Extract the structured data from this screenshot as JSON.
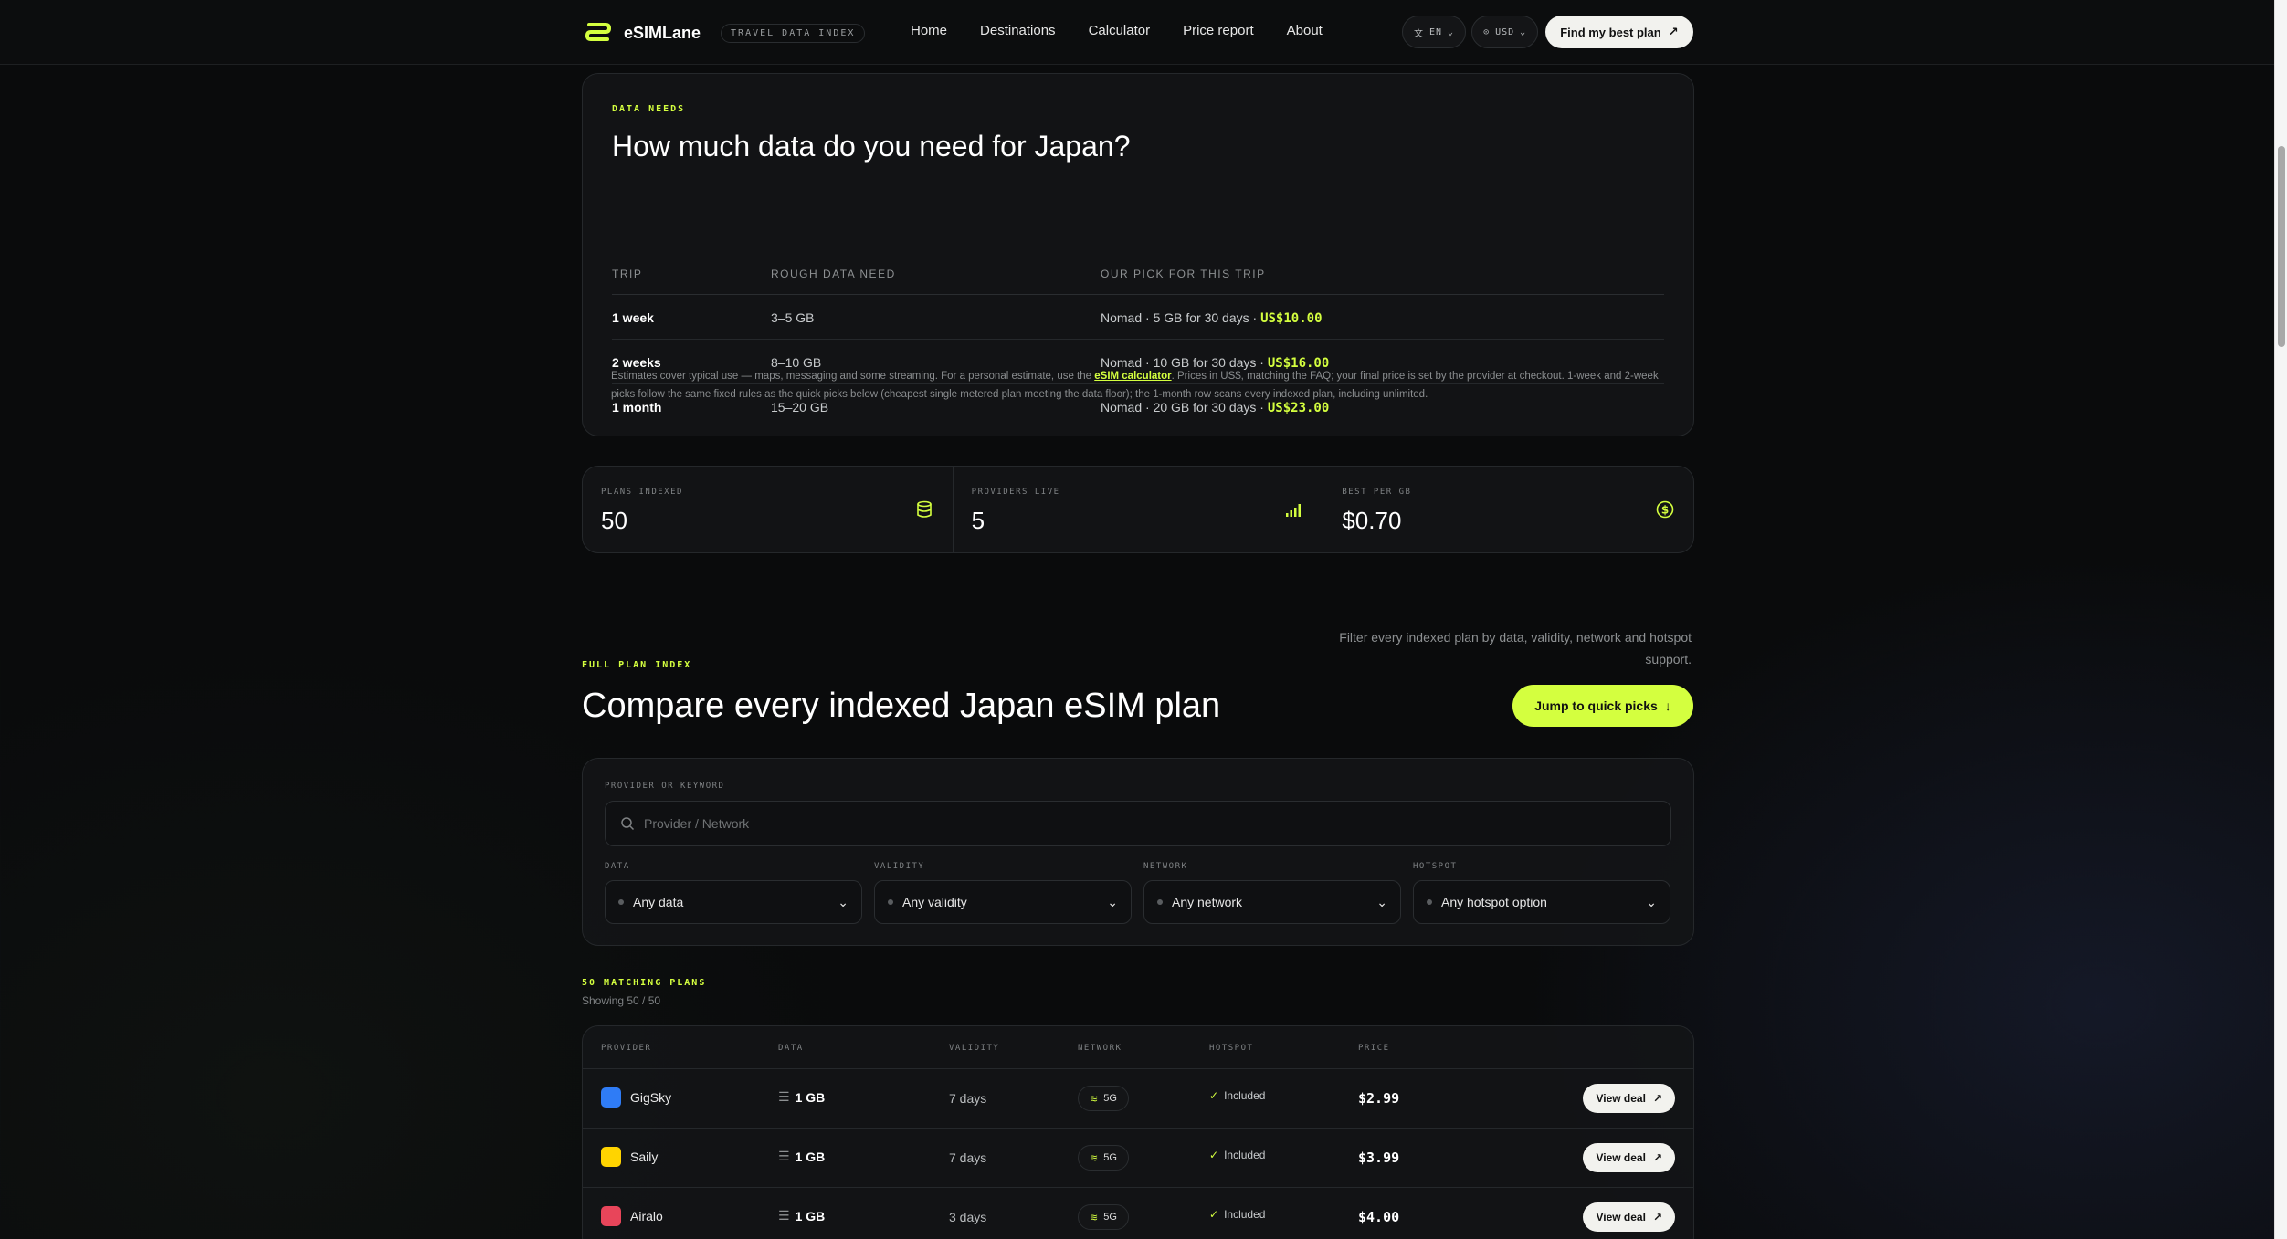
{
  "header": {
    "brand": "eSIMLane",
    "badge": "TRAVEL DATA INDEX",
    "nav": [
      "Home",
      "Destinations",
      "Calculator",
      "Price report",
      "About"
    ],
    "lang": "EN",
    "currency": "USD",
    "cta": "Find my best plan"
  },
  "needs": {
    "eyebrow": "DATA NEEDS",
    "title": "How much data do you need for Japan?",
    "columns": [
      "TRIP",
      "ROUGH DATA NEED",
      "OUR PICK FOR THIS TRIP"
    ],
    "rows": [
      {
        "trip": "1 week",
        "need": "3–5 GB",
        "pick": "Nomad · 5 GB for 30 days · ",
        "price": "US$10.00"
      },
      {
        "trip": "2 weeks",
        "need": "8–10 GB",
        "pick": "Nomad · 10 GB for 30 days · ",
        "price": "US$16.00"
      },
      {
        "trip": "1 month",
        "need": "15–20 GB",
        "pick": "Nomad · 20 GB for 30 days · ",
        "price": "US$23.00"
      }
    ],
    "note_pre": "Estimates cover typical use — maps, messaging and some streaming. For a personal estimate, use the ",
    "note_link": "eSIM calculator",
    "note_post": ". Prices in US$, matching the FAQ; your final price is set by the provider at checkout. 1-week and 2-week picks follow the same fixed rules as the quick picks below (cheapest single metered plan meeting the data floor); the 1-month row scans every indexed plan, including unlimited."
  },
  "stats": [
    {
      "label": "PLANS INDEXED",
      "value": "50",
      "icon": "database-icon"
    },
    {
      "label": "PROVIDERS LIVE",
      "value": "5",
      "icon": "signal-icon"
    },
    {
      "label": "BEST PER GB",
      "value": "$0.70",
      "icon": "dollar-icon"
    }
  ],
  "compare": {
    "eyebrow": "FULL PLAN INDEX",
    "title": "Compare every indexed Japan eSIM plan",
    "note": "Filter every indexed plan by data, validity, network and hotspot support.",
    "jump": "Jump to quick picks"
  },
  "filters": {
    "keyword_label": "PROVIDER OR KEYWORD",
    "keyword_placeholder": "Provider / Network",
    "data_label": "DATA",
    "data_value": "Any data",
    "validity_label": "VALIDITY",
    "validity_value": "Any validity",
    "network_label": "NETWORK",
    "network_value": "Any network",
    "hotspot_label": "HOTSPOT",
    "hotspot_value": "Any hotspot option"
  },
  "results": {
    "eyebrow": "50 MATCHING PLANS",
    "showing": "Showing 50 / 50",
    "columns": [
      "PROVIDER",
      "DATA",
      "VALIDITY",
      "NETWORK",
      "HOTSPOT",
      "PRICE"
    ],
    "rows": [
      {
        "provider": "GigSky",
        "data": "1 GB",
        "validity": "7 days",
        "network": "5G",
        "hotspot": "Included",
        "price": "$2.99",
        "cta": "View deal",
        "logo_color": "#2f7cf6"
      },
      {
        "provider": "Saily",
        "data": "1 GB",
        "validity": "7 days",
        "network": "5G",
        "hotspot": "Included",
        "price": "$3.99",
        "cta": "View deal",
        "logo_color": "#ffd400"
      },
      {
        "provider": "Airalo",
        "data": "1 GB",
        "validity": "3 days",
        "network": "5G",
        "hotspot": "Included",
        "price": "$4.00",
        "cta": "View deal",
        "logo_color": "#e8455a"
      }
    ]
  },
  "colors": {
    "accent": "#d4ff3f",
    "background": "#0a0b0c"
  }
}
